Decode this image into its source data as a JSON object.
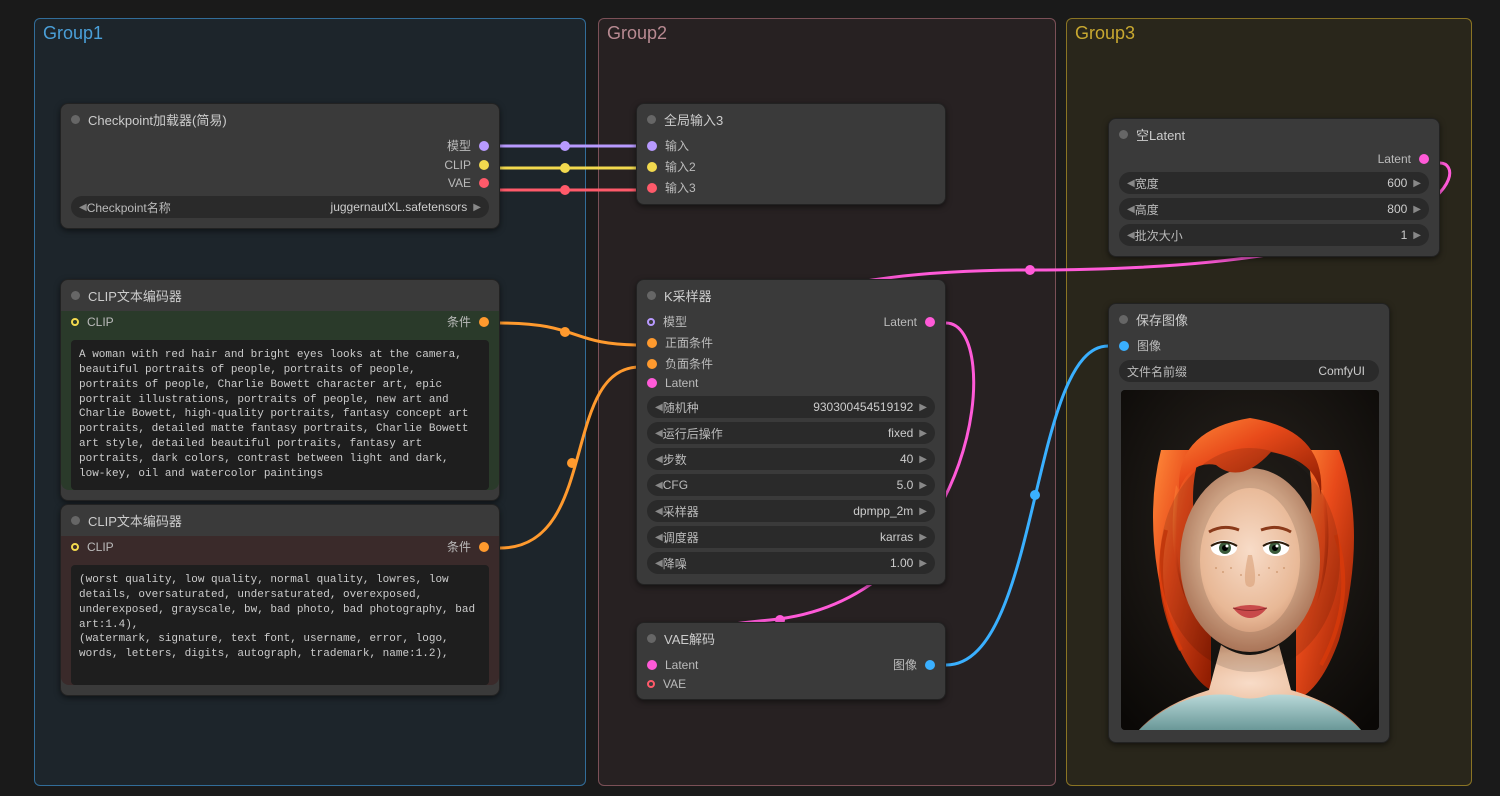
{
  "groups": {
    "g1": {
      "title": "Group1"
    },
    "g2": {
      "title": "Group2"
    },
    "g3": {
      "title": "Group3"
    }
  },
  "nodes": {
    "checkpoint": {
      "title": "Checkpoint加载器(简易)",
      "outputs": {
        "model": "模型",
        "clip": "CLIP",
        "vae": "VAE"
      },
      "widget": {
        "label": "Checkpoint名称",
        "value": "juggernautXL.safetensors"
      }
    },
    "clip_pos": {
      "title": "CLIP文本编码器",
      "input": "CLIP",
      "output": "条件",
      "text": "A woman with red hair and bright eyes looks at the camera, beautiful portraits of people, portraits of people, portraits of people, Charlie Bowett character art, epic portrait illustrations, portraits of people, new art and Charlie Bowett, high-quality portraits, fantasy concept art portraits, detailed matte fantasy portraits, Charlie Bowett art style, detailed beautiful portraits, fantasy art portraits, dark colors, contrast between light and dark, low-key, oil and watercolor paintings"
    },
    "clip_neg": {
      "title": "CLIP文本编码器",
      "input": "CLIP",
      "output": "条件",
      "text": "(worst quality, low quality, normal quality, lowres, low details, oversaturated, undersaturated, overexposed, underexposed, grayscale, bw, bad photo, bad photography, bad art:1.4),\n(watermark, signature, text font, username, error, logo, words, letters, digits, autograph, trademark, name:1.2),"
    },
    "inputs3": {
      "title": "全局输入3",
      "inputs": {
        "in1": "输入",
        "in2": "输入2",
        "in3": "输入3"
      }
    },
    "ksampler": {
      "title": "K采样器",
      "inputs": {
        "model": "模型",
        "pos": "正面条件",
        "neg": "负面条件",
        "latent": "Latent"
      },
      "output": "Latent",
      "widgets": [
        {
          "label": "随机种",
          "value": "930300454519192"
        },
        {
          "label": "运行后操作",
          "value": "fixed"
        },
        {
          "label": "步数",
          "value": "40"
        },
        {
          "label": "CFG",
          "value": "5.0"
        },
        {
          "label": "采样器",
          "value": "dpmpp_2m"
        },
        {
          "label": "调度器",
          "value": "karras"
        },
        {
          "label": "降噪",
          "value": "1.00"
        }
      ]
    },
    "vae_decode": {
      "title": "VAE解码",
      "inputs": {
        "latent": "Latent",
        "vae": "VAE"
      },
      "output": "图像"
    },
    "empty_latent": {
      "title": "空Latent",
      "output": "Latent",
      "widgets": [
        {
          "label": "宽度",
          "value": "600"
        },
        {
          "label": "高度",
          "value": "800"
        },
        {
          "label": "批次大小",
          "value": "1"
        }
      ]
    },
    "save_image": {
      "title": "保存图像",
      "input": "图像",
      "widget": {
        "label": "文件名前缀",
        "value": "ComfyUI"
      }
    }
  },
  "colors": {
    "model": "#b89aff",
    "clip": "#f2d94e",
    "vae": "#ff5a6a",
    "cond": "#ff9a2e",
    "latent": "#ff5ad8",
    "image": "#3ab0ff"
  }
}
